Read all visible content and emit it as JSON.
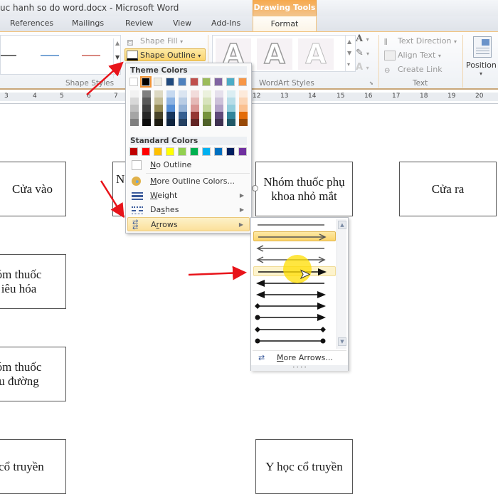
{
  "window": {
    "title": "uc hanh so do word.docx  -  Microsoft Word"
  },
  "ribbon_tabs": [
    {
      "label": "References"
    },
    {
      "label": "Mailings"
    },
    {
      "label": "Review"
    },
    {
      "label": "View"
    },
    {
      "label": "Add-Ins"
    }
  ],
  "contextual_tab": {
    "header": "Drawing Tools",
    "label": "Format"
  },
  "ribbon": {
    "shape_styles": {
      "label": "Shape Styles",
      "line_colors": [
        "#6e6e6e",
        "#7aa6d6",
        "#d98880"
      ]
    },
    "shape_fill_label": "Shape Fill",
    "shape_outline_label": "Shape Outline",
    "wordart": {
      "label": "WordArt Styles",
      "letters": [
        "A",
        "A",
        "A"
      ]
    },
    "text_group": {
      "label": "Text",
      "text_direction": "Text Direction",
      "align_text": "Align Text",
      "create_link": "Create Link"
    },
    "position_label": "Position"
  },
  "ruler": {
    "left_numbers": [
      "3",
      "4",
      "5",
      "6",
      "7"
    ],
    "right_numbers": [
      "12",
      "13",
      "14",
      "15",
      "16",
      "17",
      "18",
      "19",
      "20"
    ]
  },
  "outline_menu": {
    "theme_colors_label": "Theme Colors",
    "theme_colors": [
      "#ffffff",
      "#000000",
      "#eeece1",
      "#1f497d",
      "#4f81bd",
      "#c0504d",
      "#9bbb59",
      "#8064a2",
      "#4bacc6",
      "#f79646"
    ],
    "theme_shades": [
      [
        "#f2f2f2",
        "#d8d8d8",
        "#bfbfbf",
        "#a5a5a5",
        "#7f7f7f"
      ],
      [
        "#7f7f7f",
        "#595959",
        "#3f3f3f",
        "#262626",
        "#0c0c0c"
      ],
      [
        "#ddd9c3",
        "#c4bd97",
        "#938953",
        "#494429",
        "#1d1b10"
      ],
      [
        "#c6d9f0",
        "#8db3e2",
        "#548dd4",
        "#17365d",
        "#0f243e"
      ],
      [
        "#dbe5f1",
        "#b8cce4",
        "#95b3d7",
        "#366092",
        "#244061"
      ],
      [
        "#f2dcdb",
        "#e5b9b7",
        "#d99694",
        "#953734",
        "#632423"
      ],
      [
        "#ebf1dd",
        "#d7e3bc",
        "#c3d69b",
        "#76923c",
        "#4f6128"
      ],
      [
        "#e5e0ec",
        "#ccc1d9",
        "#b2a2c7",
        "#5f497a",
        "#3f3151"
      ],
      [
        "#dbeef3",
        "#b7dde8",
        "#92cddc",
        "#31859b",
        "#205867"
      ],
      [
        "#fdeada",
        "#fbd5b5",
        "#fac08f",
        "#e36c09",
        "#974806"
      ]
    ],
    "selected_theme_color": "#000000",
    "standard_colors_label": "Standard Colors",
    "standard_colors": [
      "#c00000",
      "#ff0000",
      "#ffc000",
      "#ffff00",
      "#92d050",
      "#00b050",
      "#00b0f0",
      "#0070c0",
      "#002060",
      "#7030a0"
    ],
    "items": [
      {
        "label": "No Outline",
        "icon": "empty-swatch-icon",
        "submenu": false
      },
      {
        "label": "More Outline Colors...",
        "icon": "palette-icon",
        "submenu": false
      },
      {
        "label": "Weight",
        "icon": "line-weight-icon",
        "submenu": true
      },
      {
        "label": "Dashes",
        "icon": "dashes-icon",
        "submenu": true
      },
      {
        "label": "Arrows",
        "icon": "arrows-icon",
        "submenu": true,
        "highlighted": true
      }
    ]
  },
  "arrows_submenu": {
    "options": [
      {
        "style": "plain-line"
      },
      {
        "style": "open-arrow-right",
        "selected": true
      },
      {
        "style": "open-arrow-left"
      },
      {
        "style": "open-arrow-both"
      },
      {
        "style": "solid-arrow-right",
        "hover": true
      },
      {
        "style": "solid-arrow-left"
      },
      {
        "style": "solid-arrow-both"
      },
      {
        "style": "diamond-to-arrow"
      },
      {
        "style": "dot-to-arrow"
      },
      {
        "style": "diamond-both"
      },
      {
        "style": "dot-both"
      }
    ],
    "more_label": "More Arrows..."
  },
  "document": {
    "boxes": [
      {
        "text": "Cửa vào"
      },
      {
        "text": "N"
      },
      {
        "text": "Nhóm thuốc phụ khoa nhỏ mắt"
      },
      {
        "text": "Cửa ra"
      },
      {
        "text": "óm thuốc\niêu hóa"
      },
      {
        "text": "óm thuốc\nu đường"
      },
      {
        "text": "c cổ truyền"
      },
      {
        "text": "Y học cổ truyền"
      }
    ]
  }
}
